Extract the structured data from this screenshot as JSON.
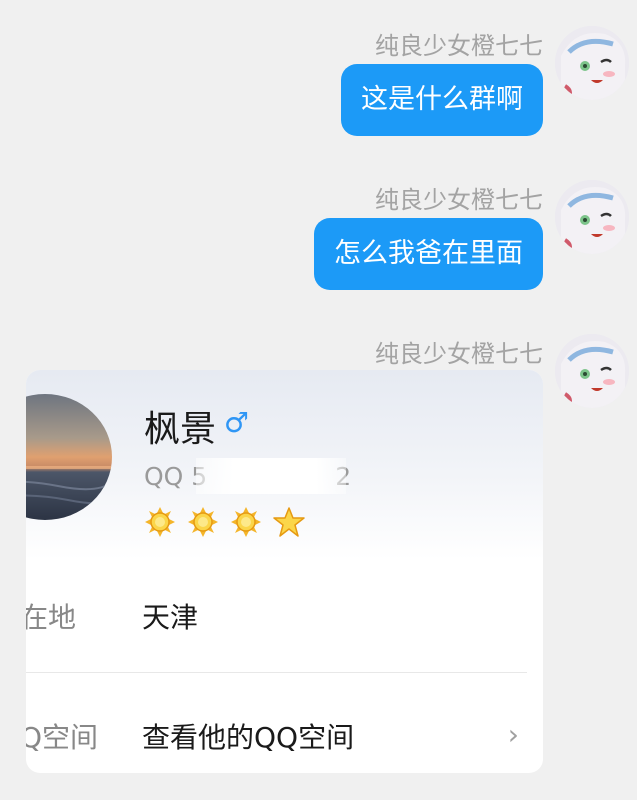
{
  "messages": [
    {
      "sender": "纯良少女橙七七",
      "text": "这是什么群啊"
    },
    {
      "sender": "纯良少女橙七七",
      "text": "怎么我爸在里面"
    },
    {
      "sender": "纯良少女橙七七"
    }
  ],
  "card": {
    "name": "枫景",
    "gender_symbol": "♂",
    "qq_prefix": "QQ 5",
    "qq_suffix": "2",
    "levels": [
      "sun-icon",
      "sun-icon",
      "sun-icon",
      "star-icon"
    ],
    "location_label": "在地",
    "location_value": "天津",
    "qzone_label": "Q空间",
    "qzone_value": "查看他的QQ空间",
    "chevron": "›"
  },
  "colors": {
    "bubble": "#1c9af7",
    "gender": "#2f96f5",
    "level_gold": "#f2b21c"
  }
}
